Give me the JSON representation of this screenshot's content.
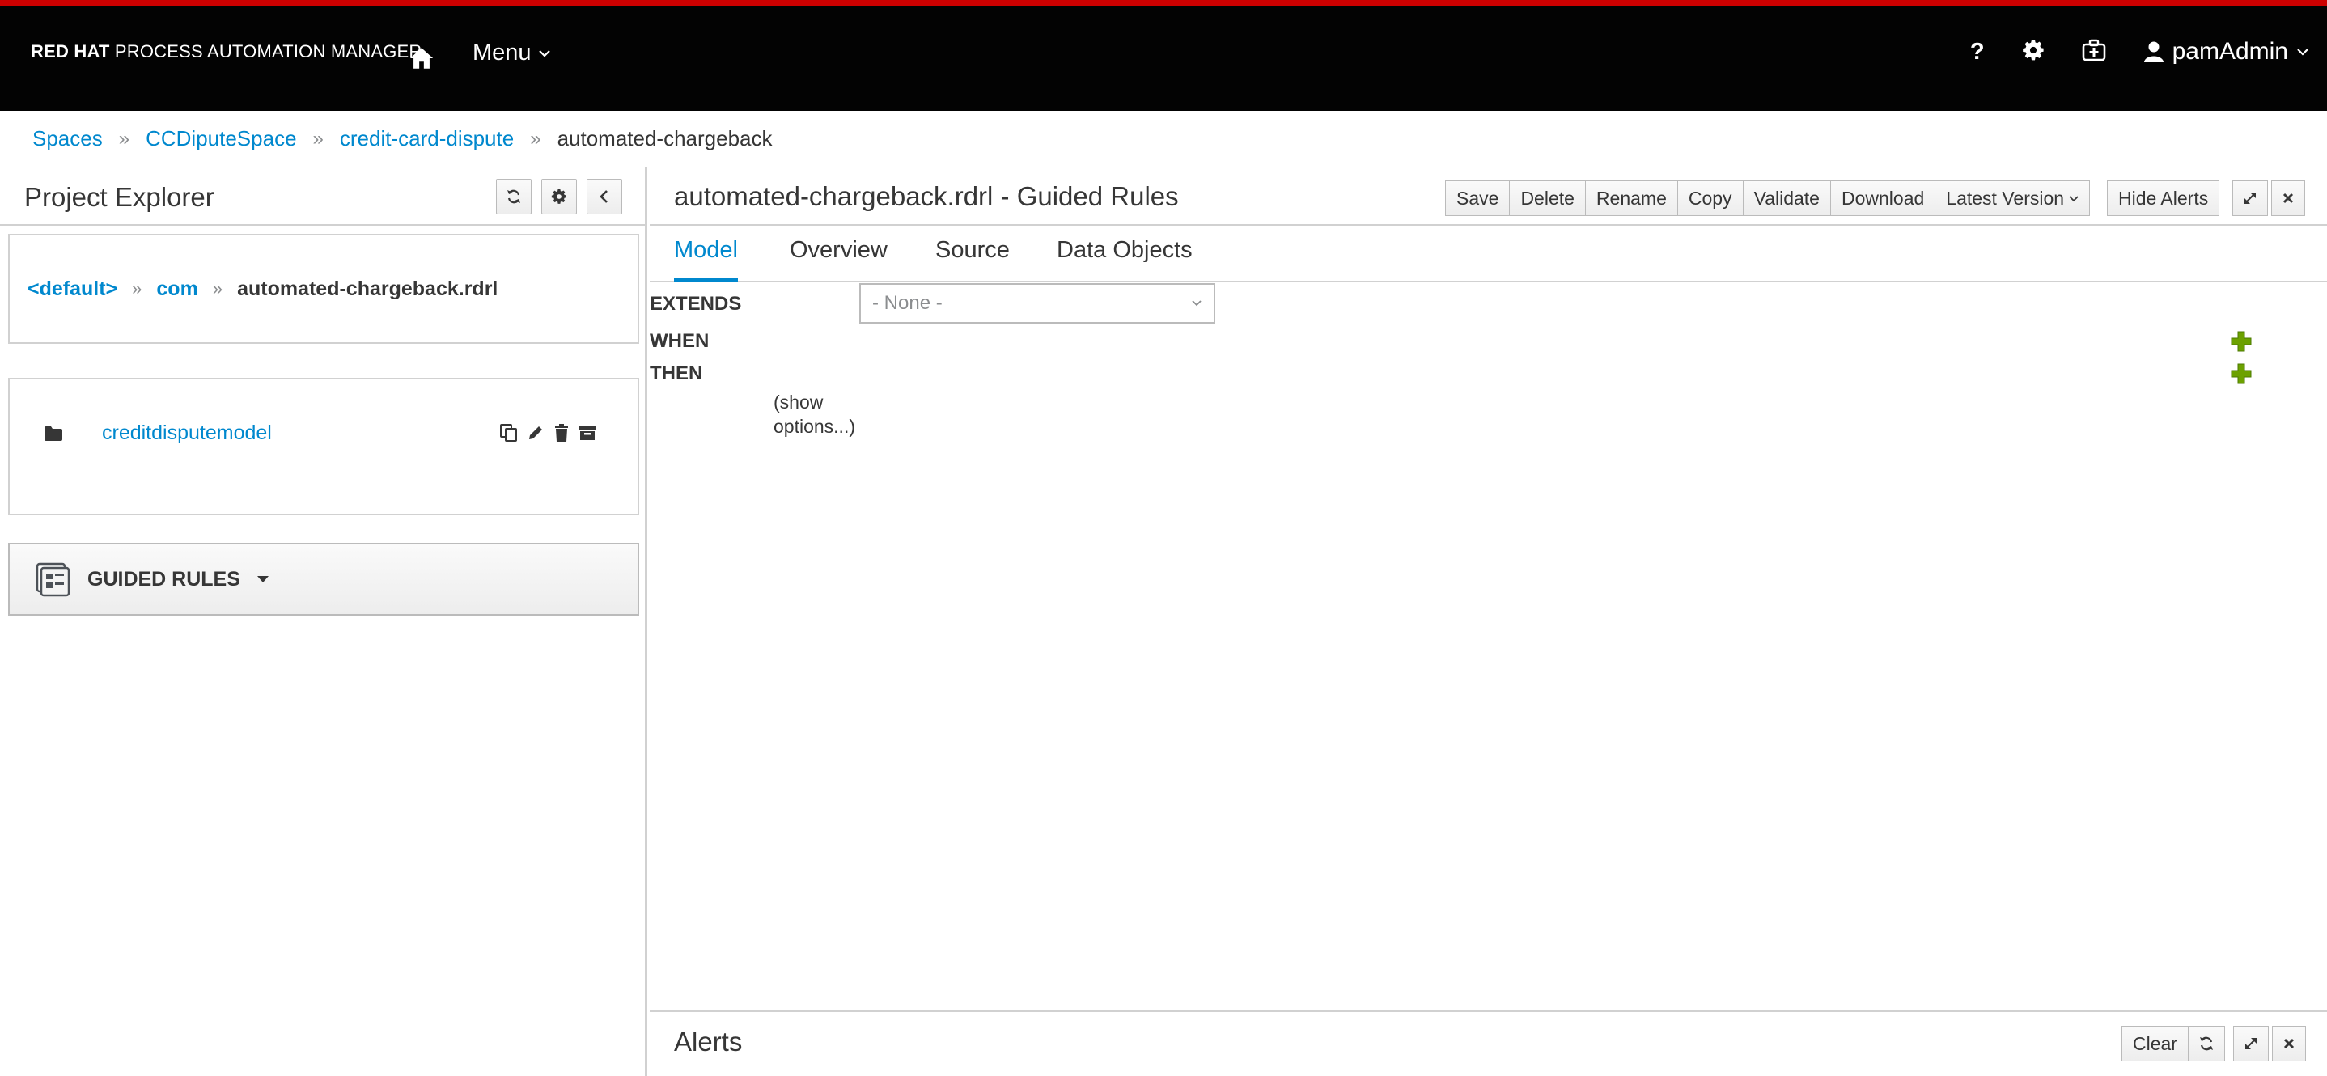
{
  "header": {
    "brand_bold": "RED HAT",
    "brand_rest": "PROCESS AUTOMATION MANAGER",
    "menu_label": "Menu",
    "help_label": "?",
    "user_name": "pamAdmin"
  },
  "breadcrumb": {
    "items": [
      "Spaces",
      "CCDiputeSpace",
      "credit-card-dispute"
    ],
    "current": "automated-chargeback",
    "separator": "»"
  },
  "explorer": {
    "title": "Project Explorer",
    "package_path": [
      "<default>",
      "com"
    ],
    "package_current": "automated-chargeback.rdrl",
    "folder_name": "creditdisputemodel",
    "asset_type_label": "GUIDED RULES"
  },
  "editor": {
    "title": "automated-chargeback.rdrl - Guided Rules",
    "toolbar": {
      "save": "Save",
      "delete": "Delete",
      "rename": "Rename",
      "copy": "Copy",
      "validate": "Validate",
      "download": "Download",
      "latest_version": "Latest Version",
      "hide_alerts": "Hide Alerts"
    },
    "tabs": [
      "Model",
      "Overview",
      "Source",
      "Data Objects"
    ],
    "active_tab": "Model",
    "model": {
      "extends_label": "EXTENDS",
      "extends_value": "- None -",
      "when_label": "WHEN",
      "then_label": "THEN",
      "show_options": "(show options...)"
    }
  },
  "alerts": {
    "title": "Alerts",
    "clear_label": "Clear"
  },
  "colors": {
    "accent": "#cc0000",
    "link": "#0088ce",
    "topbar_bg": "#030303",
    "add_green": "#6ca100"
  }
}
